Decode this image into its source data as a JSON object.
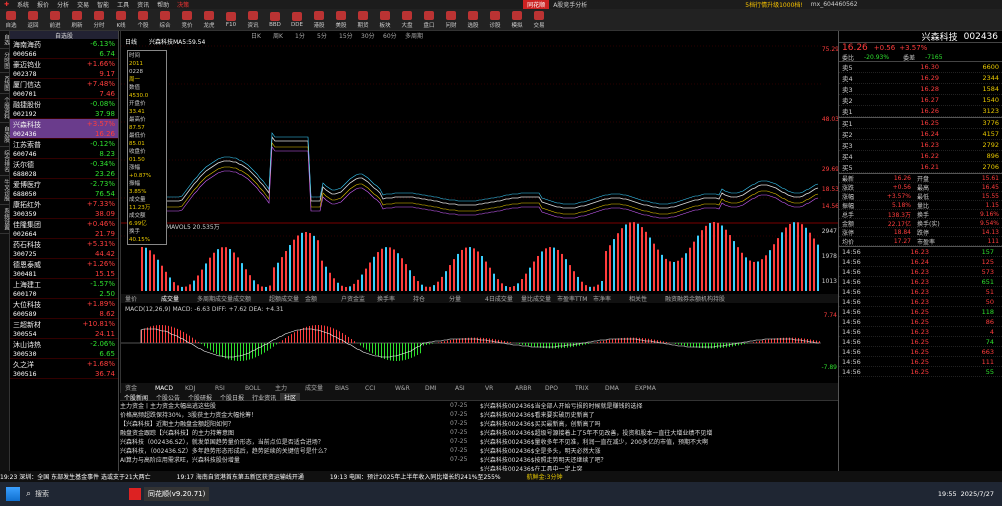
{
  "menu": [
    "系统",
    "报价",
    "分析",
    "交易",
    "智能",
    "工具",
    "资讯",
    "帮助",
    "决策",
    "同花顺",
    "A股竞手分析",
    "5档行情升级1000档!",
    "mx_604460562"
  ],
  "toolbar": [
    "自选",
    "返回",
    "前进",
    "刷新",
    "分时",
    "K线",
    "个股",
    "综合",
    "竞价",
    "龙虎",
    "F10",
    "资讯",
    "BBD",
    "DDE",
    "港股",
    "美股",
    "期货",
    "板块",
    "大盘",
    "盘口",
    "问财",
    "选股",
    "诊股",
    "模拟",
    "交易"
  ],
  "vtabs": [
    "自选",
    "分时图",
    "K线图",
    "个股资料",
    "自选股",
    "综合排名",
    "牛叉诊股",
    "系统设置"
  ],
  "watchlist": {
    "header": "自选股",
    "items": [
      {
        "name": "海南海药",
        "code": "000566",
        "pct": "-6.13%",
        "price": "6.74",
        "dir": "dn"
      },
      {
        "name": "豪迈钨业",
        "code": "002378",
        "pct": "+1.66%",
        "price": "9.17",
        "dir": "up"
      },
      {
        "name": "厦门信达",
        "code": "000701",
        "pct": "+7.48%",
        "price": "7.46",
        "dir": "up"
      },
      {
        "name": "融捷股份",
        "code": "002192",
        "pct": "-0.08%",
        "price": "37.98",
        "dir": "dn"
      },
      {
        "name": "兴森科技",
        "code": "002436",
        "pct": "+3.57%",
        "price": "16.26",
        "dir": "up"
      },
      {
        "name": "江苏索普",
        "code": "600746",
        "pct": "-0.12%",
        "price": "8.23",
        "dir": "dn"
      },
      {
        "name": "沃尔德",
        "code": "688028",
        "pct": "-0.34%",
        "price": "23.26",
        "dir": "dn"
      },
      {
        "name": "爱博医疗",
        "code": "688050",
        "pct": "-2.73%",
        "price": "76.54",
        "dir": "dn"
      },
      {
        "name": "康拓红外",
        "code": "300359",
        "pct": "+7.33%",
        "price": "38.09",
        "dir": "up"
      },
      {
        "name": "佳隆集团",
        "code": "002664",
        "pct": "+0.46%",
        "price": "21.79",
        "dir": "up"
      },
      {
        "name": "药石科技",
        "code": "300725",
        "pct": "+5.31%",
        "price": "44.42",
        "dir": "up"
      },
      {
        "name": "德恩泰威",
        "code": "300481",
        "pct": "+1.26%",
        "price": "15.15",
        "dir": "up"
      },
      {
        "name": "上海建工",
        "code": "600170",
        "pct": "-1.57%",
        "price": "2.50",
        "dir": "dn"
      },
      {
        "name": "大位科技",
        "code": "600589",
        "pct": "+1.89%",
        "price": "8.62",
        "dir": "up"
      },
      {
        "name": "三超新材",
        "code": "300554",
        "pct": "+10.81%",
        "price": "24.11",
        "dir": "up"
      },
      {
        "name": "沐山诗热",
        "code": "300530",
        "pct": "-2.06%",
        "price": "6.65",
        "dir": "dn"
      },
      {
        "name": "久之洋",
        "code": "300516",
        "pct": "+1.68%",
        "price": "36.74",
        "dir": "up"
      }
    ]
  },
  "chart": {
    "tabs": [
      "日线",
      "兴森科技",
      "MA5:59.54"
    ],
    "period": [
      "日K",
      "周K",
      "1分",
      "5分",
      "15分",
      "30分",
      "60分",
      "多周期"
    ],
    "pricelabels": [
      "75.29",
      "48.03",
      "29.69",
      "18.53",
      "14.56"
    ],
    "mavol": "MAVOL5 20.535万",
    "vollabels": [
      "2947",
      "1978",
      "1013"
    ],
    "indicator_tabs": [
      "量价",
      "成交量",
      "多周期成交量",
      "成交额",
      "超额成交量",
      "金额",
      "户资金监",
      "换手率",
      "持仓",
      "分量",
      "4日成交量",
      "量比成交量",
      "市盈率TTM",
      "市净率",
      "相关性",
      "融资融券余额",
      "机构持股"
    ],
    "macd_label": "MACD(12,26,9)  MACD: -6.63  DIFF: +7.62  DEA: +4.31",
    "macd_vals": [
      "7.74",
      "-7.89"
    ],
    "bottom_tabs": [
      "资金",
      "MACD",
      "KDJ",
      "RSI",
      "BOLL",
      "主力",
      "成交量",
      "BIAS",
      "CCI",
      "W&R",
      "DMI",
      "ASI",
      "VR",
      "ARBR",
      "DPO",
      "TRIX",
      "DMA",
      "EXPMA"
    ],
    "infobox": [
      "时间",
      "2011",
      "0228",
      "周一",
      "数值",
      "4530.0",
      "开盘价",
      "33.41",
      "最高价",
      "87.57",
      "最低价",
      "85.01",
      "收盘价",
      "01.50",
      "涨幅",
      "+0.87%",
      "振幅",
      "3.85%",
      "成交量",
      "11.23万",
      "成交额",
      "6.99亿",
      "换手",
      "40.15%"
    ]
  },
  "quote": {
    "name": "兴森科技",
    "code": "002436",
    "price": "16.26",
    "chg": "+0.56",
    "pct": "+3.57%",
    "weibi": "-20.93%",
    "weicha": "-7165",
    "asks": [
      [
        "5",
        "16.30",
        "6600"
      ],
      [
        "4",
        "16.29",
        "2344"
      ],
      [
        "3",
        "16.28",
        "1584"
      ],
      [
        "2",
        "16.27",
        "1540"
      ],
      [
        "1",
        "16.26",
        "3123"
      ]
    ],
    "bids": [
      [
        "1",
        "16.25",
        "3776"
      ],
      [
        "2",
        "16.24",
        "4157"
      ],
      [
        "3",
        "16.23",
        "2792"
      ],
      [
        "4",
        "16.22",
        "896"
      ],
      [
        "5",
        "16.21",
        "2706"
      ]
    ],
    "stats": [
      [
        "最新",
        "16.26",
        "开盘",
        "15.61"
      ],
      [
        "涨跌",
        "+0.56",
        "最高",
        "16.45"
      ],
      [
        "涨幅",
        "+3.57%",
        "最低",
        "15.55"
      ],
      [
        "振幅",
        "5.18%",
        "量比",
        "1.15"
      ],
      [
        "总手",
        "138.3万",
        "换手",
        "9.16%"
      ],
      [
        "金额",
        "22.17亿",
        "换手(实)",
        "9.54%"
      ],
      [
        "涨停",
        "18.84",
        "跌停",
        "14.13"
      ],
      [
        "均价",
        "17.27",
        "市盈率",
        "111"
      ]
    ],
    "trades": [
      [
        "14:56",
        "16.23",
        "157"
      ],
      [
        "14:56",
        "16.24",
        "125"
      ],
      [
        "14:56",
        "16.23",
        "573"
      ],
      [
        "14:56",
        "16.23",
        "651"
      ],
      [
        "14:56",
        "16.23",
        "51"
      ],
      [
        "14:56",
        "16.23",
        "50"
      ],
      [
        "14:56",
        "16.25",
        "118"
      ],
      [
        "14:56",
        "16.25",
        "86"
      ],
      [
        "14:56",
        "16.23",
        "4"
      ],
      [
        "14:56",
        "16.25",
        "74"
      ],
      [
        "14:56",
        "16.25",
        "663"
      ],
      [
        "14:56",
        "16.25",
        "111"
      ],
      [
        "14:56",
        "16.25",
        "55"
      ]
    ]
  },
  "news": [
    [
      "主力资金丨主力资金大幅出逃这些股",
      "07-25"
    ],
    [
      "价格高频超跌保持30%，3股获主力资金大幅抢筹！",
      "07-25"
    ],
    [
      "【兴森科技】近期主力融盘金额超阳如何？",
      "07-25"
    ],
    [
      "融盘资金跟踪【兴森科技】的主力持筹意图",
      "07-25"
    ],
    [
      "兴森科技（002436.SZ），就发单国趋势量价形态，当前点位是否适合进场？",
      "07-25"
    ],
    [
      "兴森科技，（002436.SZ）多年趋势形态形成后，趋势延续的关键信号是什么？",
      "07-25"
    ],
    [
      "AI算力与高阶应用需求旺，兴森科技股份增量",
      "07-25"
    ]
  ],
  "forum": [
    "$兴森科技002436$当全部人开始亏损的时候就是赚钱的选择",
    "$兴森科技002436$看来要实破历史新高了",
    "$兴森科技002436$买买最新高，创新高了吗",
    "$兴森科技002436$超级号源接着上了5年不见改善，投资和股本一直往大增业绩不见增",
    "$兴森科技002436$量收多年不见准，利润一直在减少，200多亿的市值，预期不大啊",
    "$兴森科技002436$全是多头，明天必然大涨",
    "$兴森科技002436$按照走势明天还继续了吧？",
    "$兴森科技002436$在工具中一定上突"
  ],
  "ticker": [
    "19:23 深圳：全国 东部发生基金事件 选或支于21大两亡",
    "19:17 海南自贸港首东第五新区获资运输线开通",
    "19:13 电国：预计2025年上半年收入同比增长约241%至255%",
    "航鲜金:3分钟"
  ],
  "taskbar": [
    "搜索",
    "同花顺(v9.20.71)"
  ],
  "clock": [
    "19:55",
    "2025/7/27"
  ],
  "colors": {
    "up": "#ff3d3d",
    "down": "#2ee02e",
    "select": "#6a3c8c",
    "accent": "#e8c800"
  }
}
